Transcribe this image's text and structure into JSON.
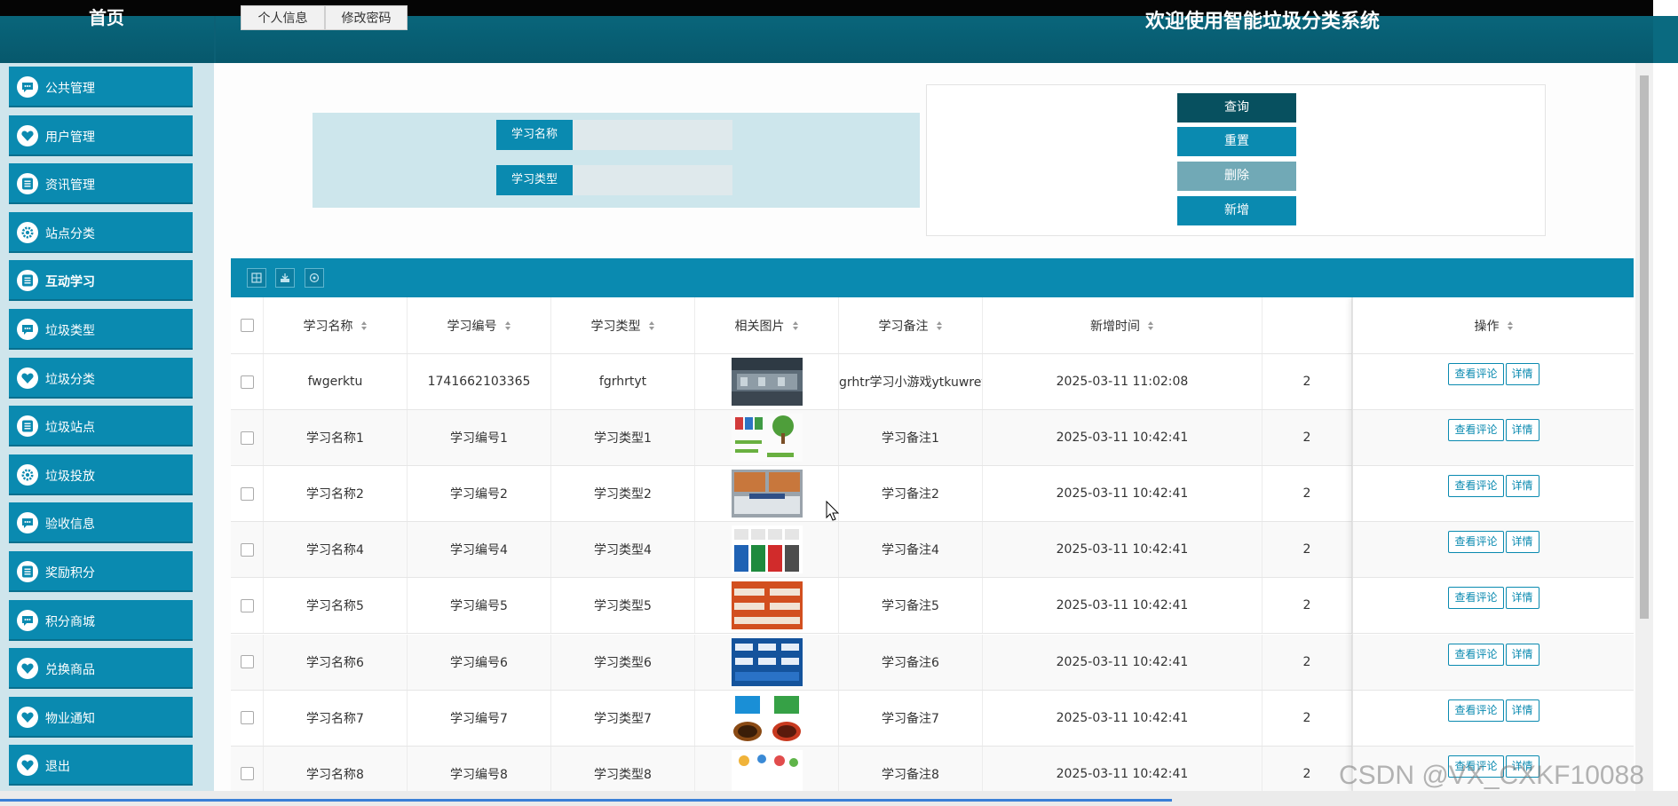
{
  "header": {
    "home_label": "首页",
    "tabs": [
      "个人信息",
      "修改密码"
    ],
    "welcome": "欢迎使用智能垃圾分类系统"
  },
  "sidebar": {
    "items": [
      {
        "label": "公共管理",
        "icon": "chat-icon"
      },
      {
        "label": "用户管理",
        "icon": "heart-icon"
      },
      {
        "label": "资讯管理",
        "icon": "list-icon"
      },
      {
        "label": "站点分类",
        "icon": "gear-icon"
      },
      {
        "label": "互动学习",
        "icon": "list-icon",
        "active": true
      },
      {
        "label": "垃圾类型",
        "icon": "chat-icon"
      },
      {
        "label": "垃圾分类",
        "icon": "heart-icon"
      },
      {
        "label": "垃圾站点",
        "icon": "list-icon"
      },
      {
        "label": "垃圾投放",
        "icon": "gear-icon"
      },
      {
        "label": "验收信息",
        "icon": "chat-icon"
      },
      {
        "label": "奖励积分",
        "icon": "list-icon"
      },
      {
        "label": "积分商城",
        "icon": "chat-icon"
      },
      {
        "label": "兑换商品",
        "icon": "heart-icon"
      },
      {
        "label": "物业通知",
        "icon": "heart-icon"
      },
      {
        "label": "退出",
        "icon": "heart-icon"
      }
    ]
  },
  "search": {
    "name_label": "学习名称",
    "name_value": "",
    "type_label": "学习类型",
    "type_value": ""
  },
  "actions": {
    "query": "查询",
    "reset": "重置",
    "delete": "删除",
    "add": "新增"
  },
  "colors": {
    "accent": "#0a8ab0",
    "query_btn": "#07505f",
    "delete_btn": "#71a9b6",
    "header": "#07586c"
  },
  "table": {
    "columns": [
      "学习名称",
      "学习编号",
      "学习类型",
      "相关图片",
      "学习备注",
      "新增时间",
      "操作"
    ],
    "row_actions": [
      "查看评论",
      "详情"
    ],
    "rows": [
      {
        "name": "fwgerktu",
        "code": "1741662103365",
        "type": "fgrhrtyt",
        "image": "warehouse",
        "note": "grhtr学习小游戏ytkuwretrj",
        "time": "2025-03-11 11:02:08",
        "extra": "2"
      },
      {
        "name": "学习名称1",
        "code": "学习编号1",
        "type": "学习类型1",
        "image": "tree-poster",
        "note": "学习备注1",
        "time": "2025-03-11 10:42:41",
        "extra": "2"
      },
      {
        "name": "学习名称2",
        "code": "学习编号2",
        "type": "学习类型2",
        "image": "sorting-chart",
        "note": "学习备注2",
        "time": "2025-03-11 10:42:41",
        "extra": "2"
      },
      {
        "name": "学习名称4",
        "code": "学习编号4",
        "type": "学习类型4",
        "image": "four-bins",
        "note": "学习备注4",
        "time": "2025-03-11 10:42:41",
        "extra": "2"
      },
      {
        "name": "学习名称5",
        "code": "学习编号5",
        "type": "学习类型5",
        "image": "orange-poster",
        "note": "学习备注5",
        "time": "2025-03-11 10:42:41",
        "extra": "2"
      },
      {
        "name": "学习名称6",
        "code": "学习编号6",
        "type": "学习类型6",
        "image": "blue-poster",
        "note": "学习备注6",
        "time": "2025-03-11 10:42:41",
        "extra": "2"
      },
      {
        "name": "学习名称7",
        "code": "学习编号7",
        "type": "学习类型7",
        "image": "bins-pair",
        "note": "学习备注7",
        "time": "2025-03-11 10:42:41",
        "extra": "2"
      },
      {
        "name": "学习名称8",
        "code": "学习编号8",
        "type": "学习类型8",
        "image": "items-poster",
        "note": "学习备注8",
        "time": "2025-03-11 10:42:41",
        "extra": "2"
      }
    ]
  },
  "watermark": "CSDN @VX_CXKF10088"
}
